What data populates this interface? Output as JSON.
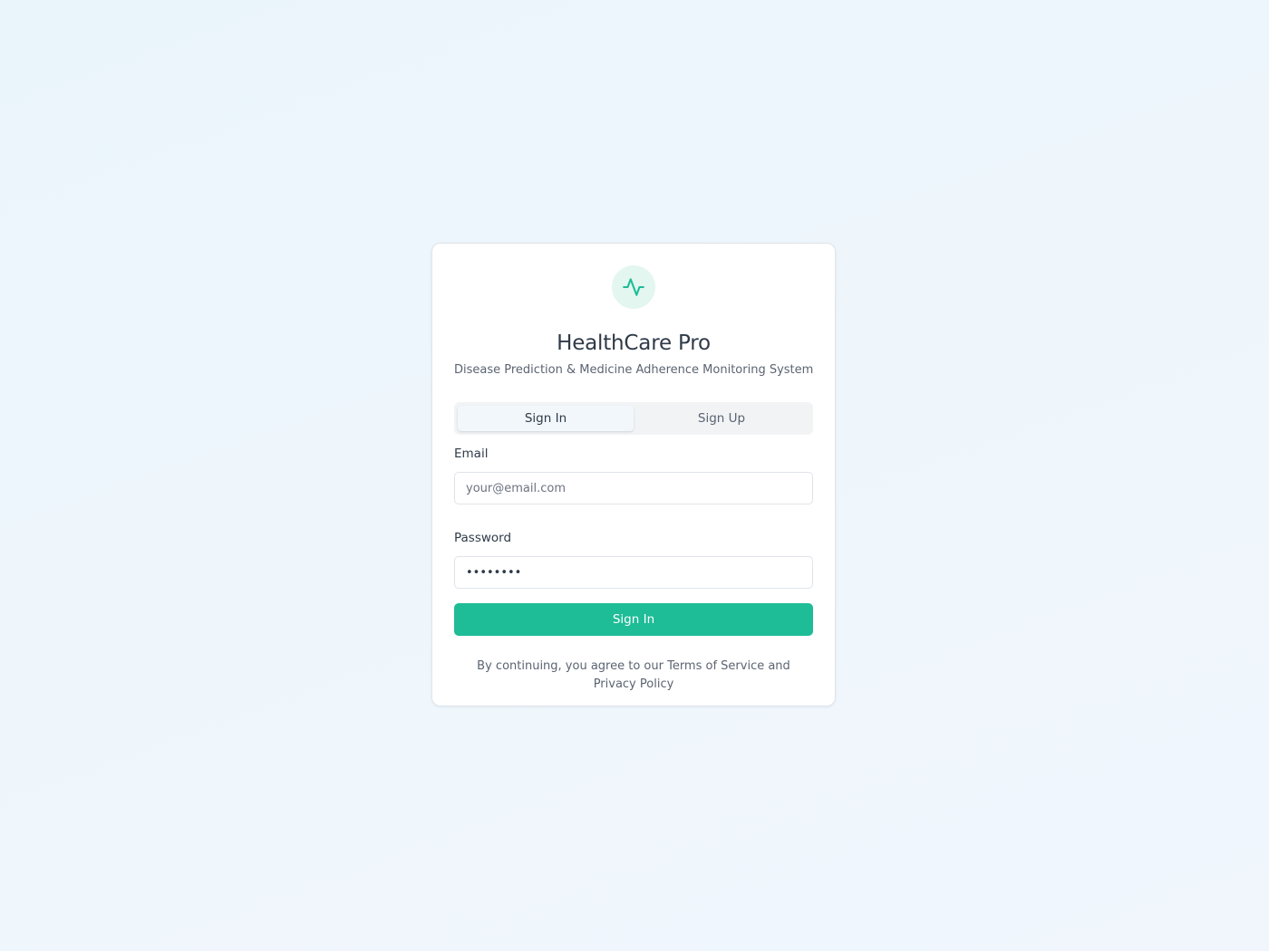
{
  "app": {
    "title": "HealthCare Pro",
    "subtitle": "Disease Prediction & Medicine Adherence Monitoring System",
    "logo_icon": "activity-pulse-icon"
  },
  "tabs": [
    {
      "label": "Sign In",
      "active": true
    },
    {
      "label": "Sign Up",
      "active": false
    }
  ],
  "form": {
    "email_label": "Email",
    "email_placeholder": "your@email.com",
    "email_value": "",
    "password_label": "Password",
    "password_value": "••••••••",
    "submit_label": "Sign In"
  },
  "footer": {
    "terms_text": "By continuing, you agree to our Terms of Service and Privacy Policy"
  },
  "colors": {
    "accent": "#1ebc97",
    "icon_bg": "#e3f6ef",
    "page_bg": "#eef6fc"
  }
}
